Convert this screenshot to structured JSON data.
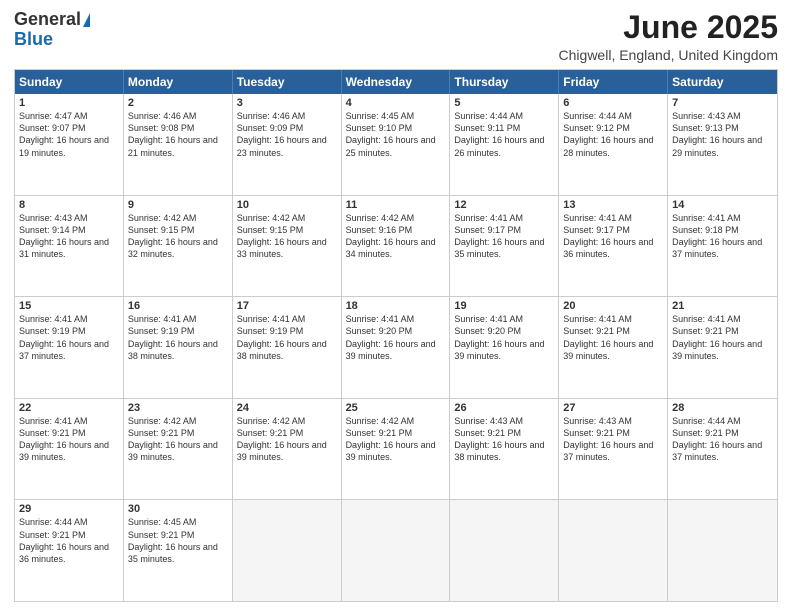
{
  "header": {
    "logo_general": "General",
    "logo_blue": "Blue",
    "title": "June 2025",
    "subtitle": "Chigwell, England, United Kingdom"
  },
  "weekdays": [
    "Sunday",
    "Monday",
    "Tuesday",
    "Wednesday",
    "Thursday",
    "Friday",
    "Saturday"
  ],
  "weeks": [
    [
      {
        "day": "1",
        "sunrise": "Sunrise: 4:47 AM",
        "sunset": "Sunset: 9:07 PM",
        "daylight": "Daylight: 16 hours and 19 minutes."
      },
      {
        "day": "2",
        "sunrise": "Sunrise: 4:46 AM",
        "sunset": "Sunset: 9:08 PM",
        "daylight": "Daylight: 16 hours and 21 minutes."
      },
      {
        "day": "3",
        "sunrise": "Sunrise: 4:46 AM",
        "sunset": "Sunset: 9:09 PM",
        "daylight": "Daylight: 16 hours and 23 minutes."
      },
      {
        "day": "4",
        "sunrise": "Sunrise: 4:45 AM",
        "sunset": "Sunset: 9:10 PM",
        "daylight": "Daylight: 16 hours and 25 minutes."
      },
      {
        "day": "5",
        "sunrise": "Sunrise: 4:44 AM",
        "sunset": "Sunset: 9:11 PM",
        "daylight": "Daylight: 16 hours and 26 minutes."
      },
      {
        "day": "6",
        "sunrise": "Sunrise: 4:44 AM",
        "sunset": "Sunset: 9:12 PM",
        "daylight": "Daylight: 16 hours and 28 minutes."
      },
      {
        "day": "7",
        "sunrise": "Sunrise: 4:43 AM",
        "sunset": "Sunset: 9:13 PM",
        "daylight": "Daylight: 16 hours and 29 minutes."
      }
    ],
    [
      {
        "day": "8",
        "sunrise": "Sunrise: 4:43 AM",
        "sunset": "Sunset: 9:14 PM",
        "daylight": "Daylight: 16 hours and 31 minutes."
      },
      {
        "day": "9",
        "sunrise": "Sunrise: 4:42 AM",
        "sunset": "Sunset: 9:15 PM",
        "daylight": "Daylight: 16 hours and 32 minutes."
      },
      {
        "day": "10",
        "sunrise": "Sunrise: 4:42 AM",
        "sunset": "Sunset: 9:15 PM",
        "daylight": "Daylight: 16 hours and 33 minutes."
      },
      {
        "day": "11",
        "sunrise": "Sunrise: 4:42 AM",
        "sunset": "Sunset: 9:16 PM",
        "daylight": "Daylight: 16 hours and 34 minutes."
      },
      {
        "day": "12",
        "sunrise": "Sunrise: 4:41 AM",
        "sunset": "Sunset: 9:17 PM",
        "daylight": "Daylight: 16 hours and 35 minutes."
      },
      {
        "day": "13",
        "sunrise": "Sunrise: 4:41 AM",
        "sunset": "Sunset: 9:17 PM",
        "daylight": "Daylight: 16 hours and 36 minutes."
      },
      {
        "day": "14",
        "sunrise": "Sunrise: 4:41 AM",
        "sunset": "Sunset: 9:18 PM",
        "daylight": "Daylight: 16 hours and 37 minutes."
      }
    ],
    [
      {
        "day": "15",
        "sunrise": "Sunrise: 4:41 AM",
        "sunset": "Sunset: 9:19 PM",
        "daylight": "Daylight: 16 hours and 37 minutes."
      },
      {
        "day": "16",
        "sunrise": "Sunrise: 4:41 AM",
        "sunset": "Sunset: 9:19 PM",
        "daylight": "Daylight: 16 hours and 38 minutes."
      },
      {
        "day": "17",
        "sunrise": "Sunrise: 4:41 AM",
        "sunset": "Sunset: 9:19 PM",
        "daylight": "Daylight: 16 hours and 38 minutes."
      },
      {
        "day": "18",
        "sunrise": "Sunrise: 4:41 AM",
        "sunset": "Sunset: 9:20 PM",
        "daylight": "Daylight: 16 hours and 39 minutes."
      },
      {
        "day": "19",
        "sunrise": "Sunrise: 4:41 AM",
        "sunset": "Sunset: 9:20 PM",
        "daylight": "Daylight: 16 hours and 39 minutes."
      },
      {
        "day": "20",
        "sunrise": "Sunrise: 4:41 AM",
        "sunset": "Sunset: 9:21 PM",
        "daylight": "Daylight: 16 hours and 39 minutes."
      },
      {
        "day": "21",
        "sunrise": "Sunrise: 4:41 AM",
        "sunset": "Sunset: 9:21 PM",
        "daylight": "Daylight: 16 hours and 39 minutes."
      }
    ],
    [
      {
        "day": "22",
        "sunrise": "Sunrise: 4:41 AM",
        "sunset": "Sunset: 9:21 PM",
        "daylight": "Daylight: 16 hours and 39 minutes."
      },
      {
        "day": "23",
        "sunrise": "Sunrise: 4:42 AM",
        "sunset": "Sunset: 9:21 PM",
        "daylight": "Daylight: 16 hours and 39 minutes."
      },
      {
        "day": "24",
        "sunrise": "Sunrise: 4:42 AM",
        "sunset": "Sunset: 9:21 PM",
        "daylight": "Daylight: 16 hours and 39 minutes."
      },
      {
        "day": "25",
        "sunrise": "Sunrise: 4:42 AM",
        "sunset": "Sunset: 9:21 PM",
        "daylight": "Daylight: 16 hours and 39 minutes."
      },
      {
        "day": "26",
        "sunrise": "Sunrise: 4:43 AM",
        "sunset": "Sunset: 9:21 PM",
        "daylight": "Daylight: 16 hours and 38 minutes."
      },
      {
        "day": "27",
        "sunrise": "Sunrise: 4:43 AM",
        "sunset": "Sunset: 9:21 PM",
        "daylight": "Daylight: 16 hours and 37 minutes."
      },
      {
        "day": "28",
        "sunrise": "Sunrise: 4:44 AM",
        "sunset": "Sunset: 9:21 PM",
        "daylight": "Daylight: 16 hours and 37 minutes."
      }
    ],
    [
      {
        "day": "29",
        "sunrise": "Sunrise: 4:44 AM",
        "sunset": "Sunset: 9:21 PM",
        "daylight": "Daylight: 16 hours and 36 minutes."
      },
      {
        "day": "30",
        "sunrise": "Sunrise: 4:45 AM",
        "sunset": "Sunset: 9:21 PM",
        "daylight": "Daylight: 16 hours and 35 minutes."
      },
      {
        "day": "",
        "sunrise": "",
        "sunset": "",
        "daylight": ""
      },
      {
        "day": "",
        "sunrise": "",
        "sunset": "",
        "daylight": ""
      },
      {
        "day": "",
        "sunrise": "",
        "sunset": "",
        "daylight": ""
      },
      {
        "day": "",
        "sunrise": "",
        "sunset": "",
        "daylight": ""
      },
      {
        "day": "",
        "sunrise": "",
        "sunset": "",
        "daylight": ""
      }
    ]
  ]
}
